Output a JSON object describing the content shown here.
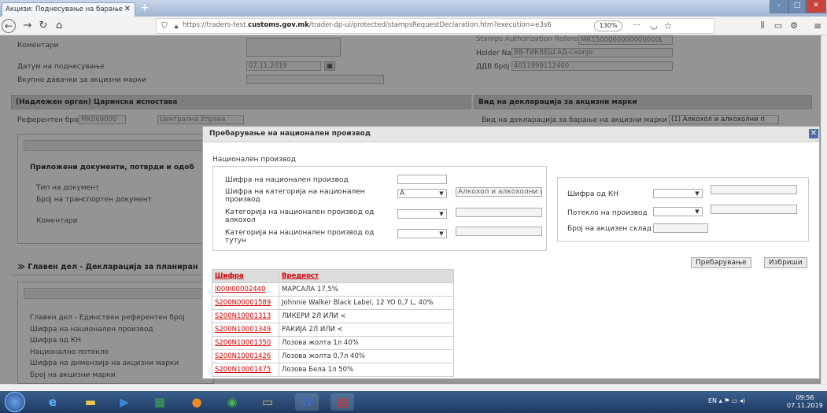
{
  "browser": {
    "tab_title": "Акцизи: Поднесување на барање",
    "tab_close": "✕",
    "new_tab": "+",
    "url_prefix": "https://traders-test.",
    "url_host": "customs.gov.mk",
    "url_path": "/trader-dp-ui/protected/stampsRequestDeclaration.htm?execution=e3s6",
    "zoom": "130%",
    "more": "···"
  },
  "page": {
    "komentari_label": "Коментари",
    "datum_label": "Датум на поднесување",
    "datum_value": "07.11.2019",
    "vkupno_label": "Вкупно давачки за акцизни марки",
    "right_top_label": "Stamps Authorization Reference",
    "right_top_value": "МК1500000000000000L",
    "holder_label": "Holder Name",
    "holder_value": "ВВ-ТИКВЕШ АД-Скопје",
    "ddv_label": "ДДВ број",
    "ddv_value": "4011999112400",
    "organ_header": "(Надлежен орган) Царинска испостава",
    "referenten_label": "Референтен број",
    "referenten_code": "MK009000",
    "referenten_name": "Централна Управа",
    "vid_header": "Вид на декларација за акцизни марки",
    "vid_label": "Вид на декларација за барање на акцизни марки",
    "vid_value": "(1) Алкохол и алкохолни п",
    "prilozeni_header": "Приложени документи, потврди и одоб",
    "tip_dok_label": "Тип на документ",
    "broj_transport_label": "Број на транспортен документ",
    "komentari2_label": "Коментари",
    "glaven_header": "Главен дел - Декларација за планиран",
    "glaven_items": [
      "Главен дел - Единствен референтен број",
      "Шифра на национален производ",
      "Шифра од КН",
      "Национално потекло",
      "Шифра на димензија на акцизни марки",
      "Број на акцизни марки"
    ]
  },
  "modal": {
    "title": "Пребарување на национален производ",
    "close": "✕",
    "section": "Национален производ",
    "f_sifra_nac": "Шифра на национален производ",
    "f_sifra_kat": "Шифра на категорија на национален производ",
    "f_sifra_kat_value": "А",
    "f_sifra_kat_desc": "Алкохол и алкохолни п",
    "f_kat_alkohol": "Категорија на национален производ од алкохол",
    "f_kat_tutun": "Категорија на национален производ од тутун",
    "f_sifra_kn": "Шифра од КН",
    "f_poteklo": "Потекло на производ",
    "f_akcizen": "Број на акцизен склад",
    "search_btn": "Пребарување",
    "clear_btn": "Избриши",
    "col_sifra": "Шифра",
    "col_vrednost": "Вредност",
    "rows": [
      {
        "code": "I000I00002440",
        "value": "МАРСАЛА 17,5%"
      },
      {
        "code": "S200N00001589",
        "value": "Johnnie Walker Black Label, 12 YO 0,7 L, 40%"
      },
      {
        "code": "S200N10001313",
        "value": "ЛИКЕРИ 2Л ИЛИ <"
      },
      {
        "code": "S200N10001349",
        "value": "РАКИЈА 2Л ИЛИ <"
      },
      {
        "code": "S200N10001350",
        "value": "Лозова жолта 1л 40%"
      },
      {
        "code": "S200N10001426",
        "value": "Лозова жолта 0,7л 40%"
      },
      {
        "code": "S200N10001475",
        "value": "Лозова Бела 1л 50%"
      }
    ]
  },
  "taskbar": {
    "lang": "EN",
    "time": "09:56",
    "date": "07.11.2019"
  },
  "icons": [
    "back-icon",
    "forward-icon",
    "reload-icon",
    "home-icon",
    "shield-icon",
    "lock-icon",
    "bookmark-icon",
    "star-icon",
    "library-icon",
    "sidebar-icon",
    "extension-icon",
    "menu-icon",
    "close-icon",
    "dropdown-arrow-icon",
    "calendar-icon"
  ]
}
